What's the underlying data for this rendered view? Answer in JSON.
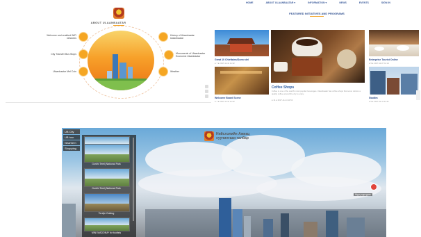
{
  "about": {
    "title": "ABOUT ULAANBAATAR",
    "left_items": [
      {
        "label": "Welcome and enabled WiFi networks"
      },
      {
        "label": "City Transfer Bus Stops"
      },
      {
        "label": "Ulaanbaatar Mel Coin"
      }
    ],
    "right_items": [
      {
        "label": "History of Ulaanbaatar Ulaanbaatar"
      },
      {
        "label": "Monuments of Ulaanbaatar Economic Ulaanbaatar"
      },
      {
        "label": "Weather"
      }
    ]
  },
  "featured": {
    "nav": [
      "HOME",
      "ABOUT ULAANBAATAR ▾",
      "INFORMATION ▾",
      "NEWS",
      "EVENTS",
      "SIGN IN"
    ],
    "title": "FEATURED INITIATIVES AND PROGRAMS",
    "cards": [
      {
        "caption": "Great 10 Chieftains/Scene del",
        "meta": "● 7 ● 2017-11-11 11:32"
      },
      {
        "caption": "Welcome Board Scene",
        "meta": "● 7 ● 2017-11-11 11:22"
      },
      {
        "caption": "Coffee Shops",
        "desc": "Coffee is one of the world's most popular beverages. Ulaanbaatar has coffee shops that serve visitors a quality coffee around the city to enjoy.",
        "meta": "● 11 ● 2017-11-14 11:53"
      },
      {
        "caption": "Enterprise Tourist Online",
        "meta": "● 5 ● 2017-11-07 11:21"
      },
      {
        "caption": "Stadiim",
        "meta": "● 5 ● 2017-11-11 11:21"
      }
    ]
  },
  "pano": {
    "logo_line1": "Нийслэлийн Ажиац",
    "logo_line2": "хуучилгаан талбар",
    "menu": [
      "UB City",
      "UB tour",
      "Nearbern",
      "Shopping"
    ],
    "thumbs": [
      {
        "label": ""
      },
      {
        "label": "Gorkhi Terelj National Park"
      },
      {
        "label": "Gorkhi Terelj National Park"
      },
      {
        "label": "Terelje Goldog"
      },
      {
        "label": "MINI MADONA* for toutists"
      }
    ],
    "hotspot_label": "Нууц сургууль"
  }
}
